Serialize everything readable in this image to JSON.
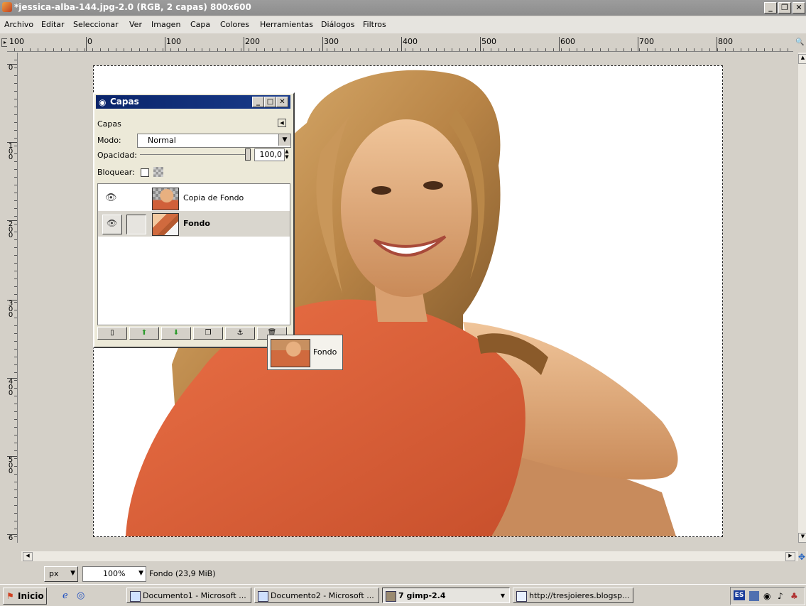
{
  "window": {
    "title": "*jessica-alba-144.jpg-2.0 (RGB, 2 capas) 800x600",
    "minimize": "_",
    "restore": "❐",
    "close": "✕"
  },
  "menu": [
    {
      "label": "Archivo"
    },
    {
      "label": "Editar"
    },
    {
      "label": "Seleccionar"
    },
    {
      "label": "Ver"
    },
    {
      "label": "Imagen"
    },
    {
      "label": "Capa"
    },
    {
      "label": "Colores"
    },
    {
      "label": "Herramientas"
    },
    {
      "label": "Diálogos"
    },
    {
      "label": "Filtros"
    }
  ],
  "rulers": {
    "horizontal_ticks": [
      "100",
      "0",
      "100",
      "200",
      "300",
      "400",
      "500",
      "600",
      "700",
      "800"
    ],
    "vertical_ticks": [
      "0",
      "100",
      "200",
      "300",
      "400",
      "500",
      "6"
    ]
  },
  "layers_dialog": {
    "title": "Capas",
    "tab_label": "Capas",
    "mode_label": "Modo:",
    "mode_value": "Normal",
    "opacity_label": "Opacidad:",
    "opacity_value": "100,0",
    "lock_label": "Bloquear:",
    "layers": [
      {
        "name": "Copia de Fondo",
        "visible": true,
        "selected": false
      },
      {
        "name": "Fondo",
        "visible": true,
        "selected": true
      }
    ],
    "buttons": [
      "new-layer",
      "raise-layer",
      "lower-layer",
      "duplicate-layer",
      "anchor-layer",
      "delete-layer"
    ]
  },
  "drag_tooltip": {
    "label": "Fondo"
  },
  "statusbar": {
    "unit": "px",
    "zoom": "100%",
    "info": "Fondo (23,9 MiB)"
  },
  "taskbar": {
    "start": "Inicio",
    "tasks": [
      {
        "label": "Documento1 - Microsoft ..."
      },
      {
        "label": "Documento2 - Microsoft ..."
      },
      {
        "label": "7 gimp-2.4"
      },
      {
        "label": "http://tresjoieres.blogsp..."
      }
    ],
    "lang": "ES"
  },
  "colors": {
    "title_bar": "#8d8d8d",
    "dialog_title": "#0a246a",
    "shirt": "#d8603a"
  }
}
